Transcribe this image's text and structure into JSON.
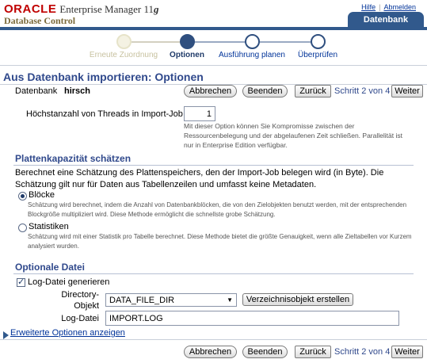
{
  "header": {
    "oracle": "ORACLE",
    "product": "Enterprise Manager 11",
    "version_letter": "g",
    "subtitle": "Database Control",
    "links": [
      "Hilfe",
      "Abmelden"
    ],
    "tab": "Datenbank"
  },
  "train": {
    "steps": [
      {
        "label": "Erneute Zuordnung",
        "state": "visited"
      },
      {
        "label": "Optionen",
        "state": "current"
      },
      {
        "label": "Ausführung planen",
        "state": "next"
      },
      {
        "label": "Überprüfen",
        "state": "next"
      }
    ]
  },
  "page": {
    "title": "Aus Datenbank importieren: Optionen",
    "db_label": "Datenbank",
    "db_value": "hirsch"
  },
  "nav": {
    "cancel": "Abbrechen",
    "finish": "Beenden",
    "back": "Zurück",
    "step": "Schritt 2 von 4",
    "next": "Weiter"
  },
  "threads": {
    "label": "Höchstanzahl von Threads in Import-Job",
    "value": "1",
    "hint": "Mit dieser Option können Sie Kompromisse zwischen der Ressourcenbelegung und der abgelaufenen Zeit schließen. Parallelität ist nur in Enterprise Edition verfügbar."
  },
  "estimate": {
    "heading": "Plattenkapazität schätzen",
    "description": "Berechnet eine Schätzung des Plattenspeichers, den der Import-Job belegen wird (in Byte). Die Schätzung gilt nur für Daten aus Tabellenzeilen und umfasst keine Metadaten.",
    "options": [
      {
        "label": "Blöcke",
        "checked": true,
        "hint": "Schätzung wird berechnet, indem die Anzahl von Datenbankblöcken, die von den Zielobjekten benutzt werden, mit der entsprechenden Blockgröße multipliziert wird. Diese Methode ermöglicht die schnellste grobe Schätzung."
      },
      {
        "label": "Statistiken",
        "checked": false,
        "hint": "Schätzung wird mit einer Statistik pro Tabelle berechnet. Diese Methode bietet die größte Genauigkeit, wenn alle Zieltabellen vor Kurzem analysiert wurden."
      }
    ]
  },
  "logfile": {
    "heading": "Optionale Datei",
    "generate_label": "Log-Datei generieren",
    "generate_checked": true,
    "directory_label_1": "Directory-",
    "directory_label_2": "Objekt",
    "directory_value": "DATA_FILE_DIR",
    "create_dir_button": "Verzeichnisobjekt erstellen",
    "file_label": "Log-Datei",
    "file_value": "IMPORT.LOG"
  },
  "advanced_link": "Erweiterte Optionen anzeigen"
}
